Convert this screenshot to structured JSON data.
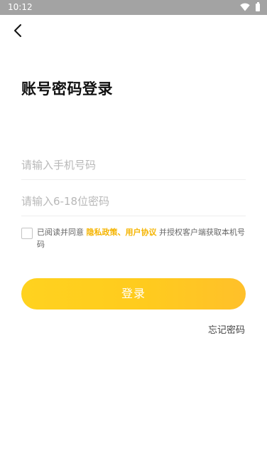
{
  "status_bar": {
    "time": "10:12",
    "icons": [
      "wifi-icon",
      "battery-icon"
    ]
  },
  "header": {
    "back_icon": "chevron-left-icon"
  },
  "page": {
    "title": "账号密码登录"
  },
  "form": {
    "phone_placeholder": "请输入手机号码",
    "phone_value": "",
    "password_placeholder": "请输入6-18位密码",
    "password_value": ""
  },
  "agreement": {
    "checked": false,
    "prefix": "已阅读并同意 ",
    "privacy_link": "隐私政策",
    "separator": "、",
    "terms_link": "用户协议",
    "suffix": " 并授权客户端获取本机号码"
  },
  "actions": {
    "login_label": "登录",
    "forgot_password_label": "忘记密码"
  },
  "colors": {
    "accent": "#ffc81f",
    "link": "#f5b400",
    "status_bar": "#a3a3a3"
  }
}
